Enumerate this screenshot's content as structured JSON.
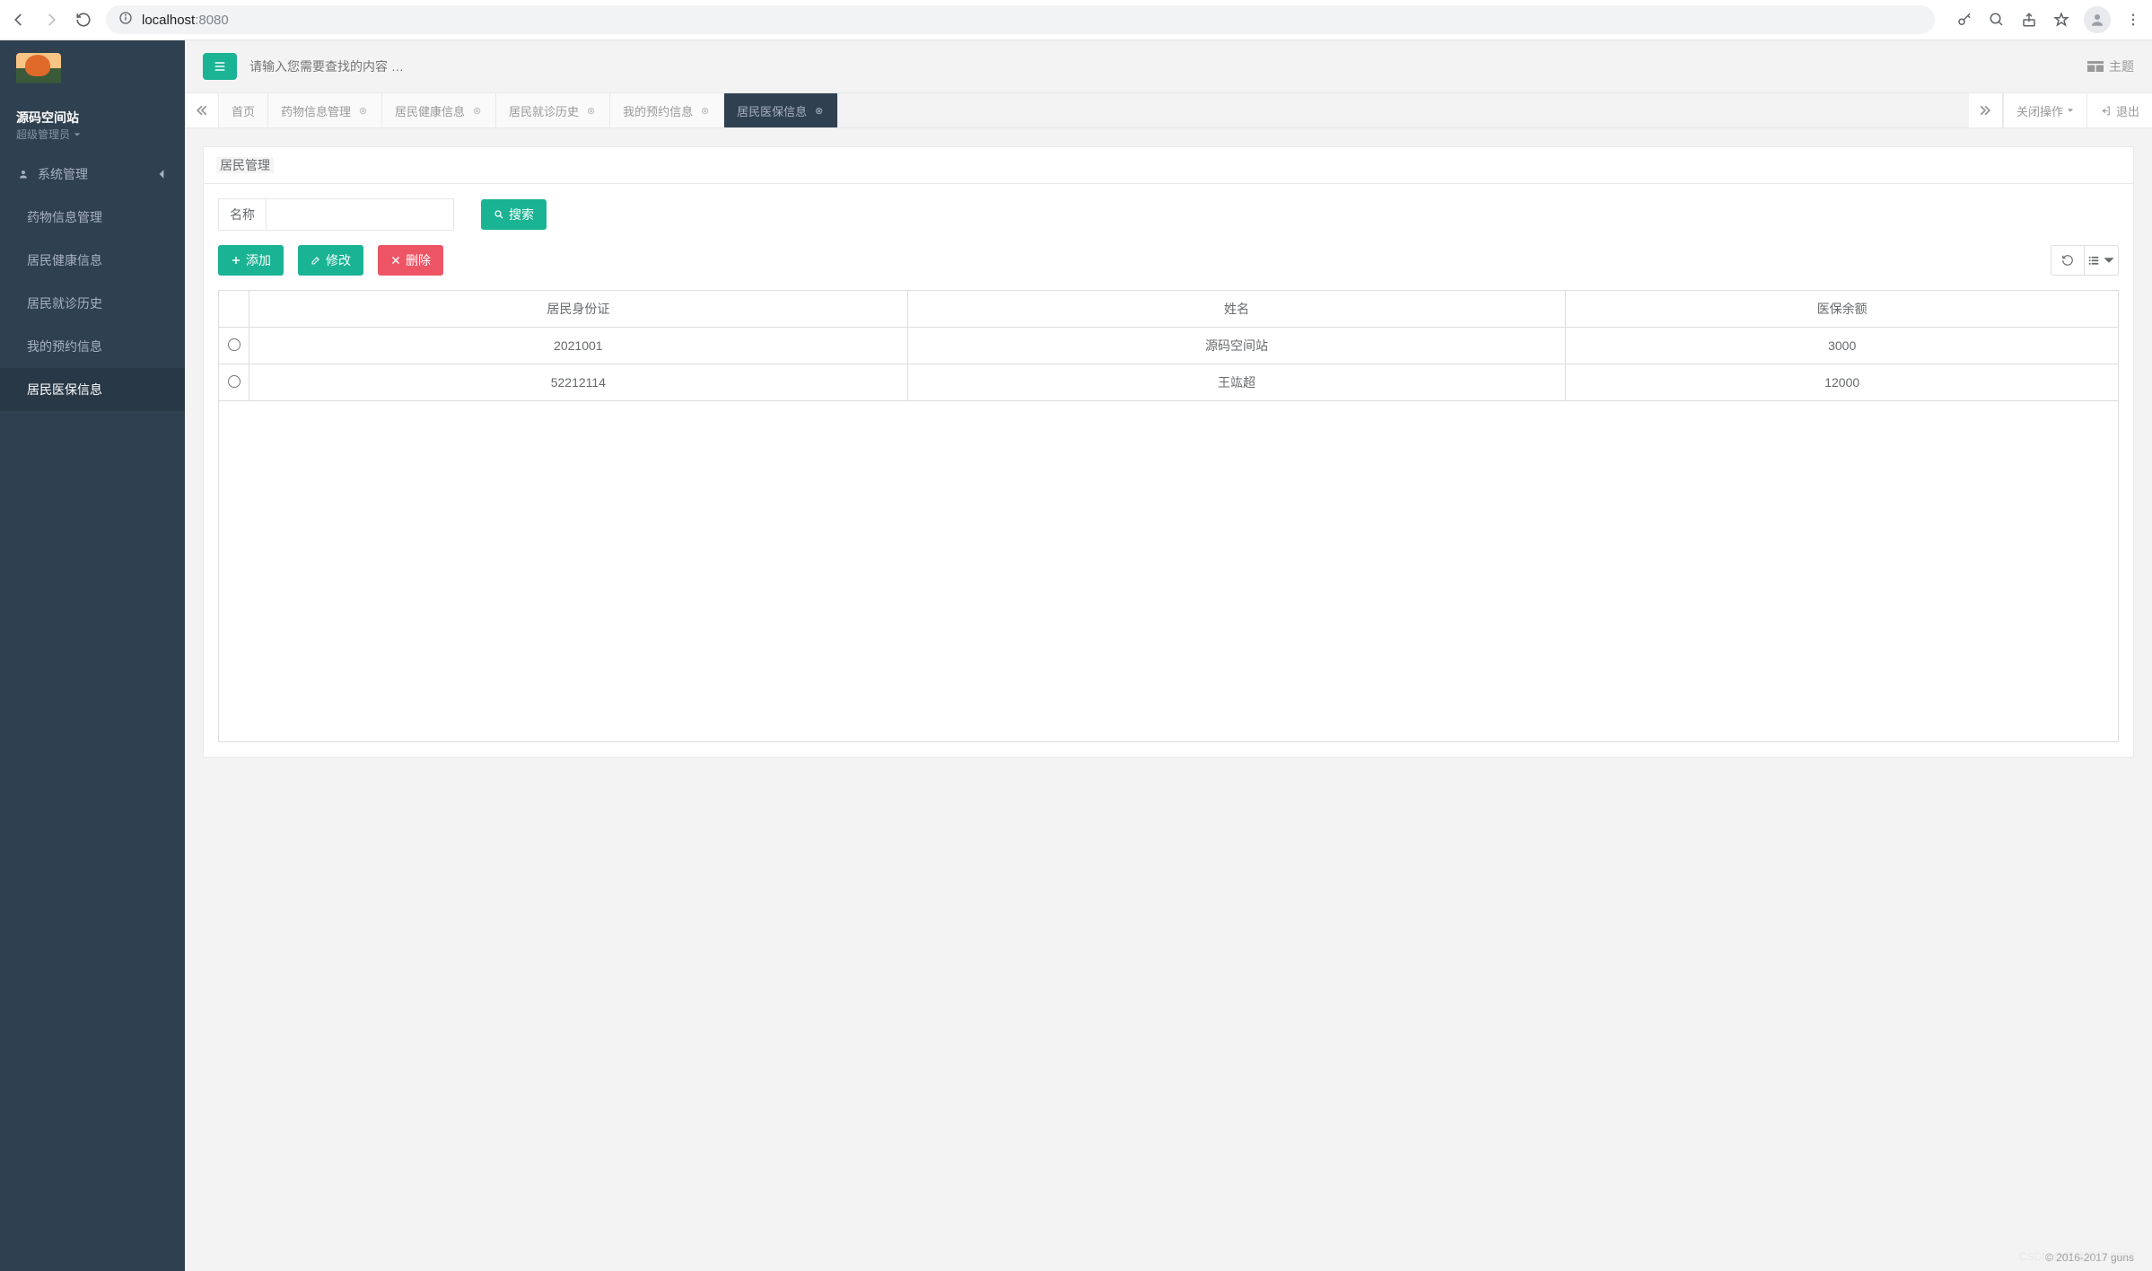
{
  "browser": {
    "url_host": "localhost",
    "url_port": ":8080"
  },
  "sidebar": {
    "site_name": "源码空间站",
    "role": "超级管理员",
    "section_label": "系统管理",
    "items": [
      {
        "label": "药物信息管理"
      },
      {
        "label": "居民健康信息"
      },
      {
        "label": "居民就诊历史"
      },
      {
        "label": "我的预约信息"
      },
      {
        "label": "居民医保信息"
      }
    ],
    "active_index": 4
  },
  "topbar": {
    "search_placeholder": "请输入您需要查找的内容 …",
    "theme_label": "主题"
  },
  "tabs": {
    "items": [
      {
        "label": "首页",
        "closable": false
      },
      {
        "label": "药物信息管理",
        "closable": true
      },
      {
        "label": "居民健康信息",
        "closable": true
      },
      {
        "label": "居民就诊历史",
        "closable": true
      },
      {
        "label": "我的预约信息",
        "closable": true
      },
      {
        "label": "居民医保信息",
        "closable": true
      }
    ],
    "active_index": 5,
    "close_dropdown_label": "关闭操作",
    "logout_label": "退出"
  },
  "panel": {
    "title": "居民管理",
    "search_field_label": "名称",
    "search_button_label": "搜索",
    "add_button_label": "添加",
    "edit_button_label": "修改",
    "delete_button_label": "删除",
    "columns": [
      "居民身份证",
      "姓名",
      "医保余额"
    ],
    "rows": [
      {
        "id": "2021001",
        "name": "源码空间站",
        "balance": "3000"
      },
      {
        "id": "52212114",
        "name": "王竑超",
        "balance": "12000"
      }
    ]
  },
  "footer": "© 2016-2017 guns",
  "watermark": "CSDN @仅此而已-0788"
}
